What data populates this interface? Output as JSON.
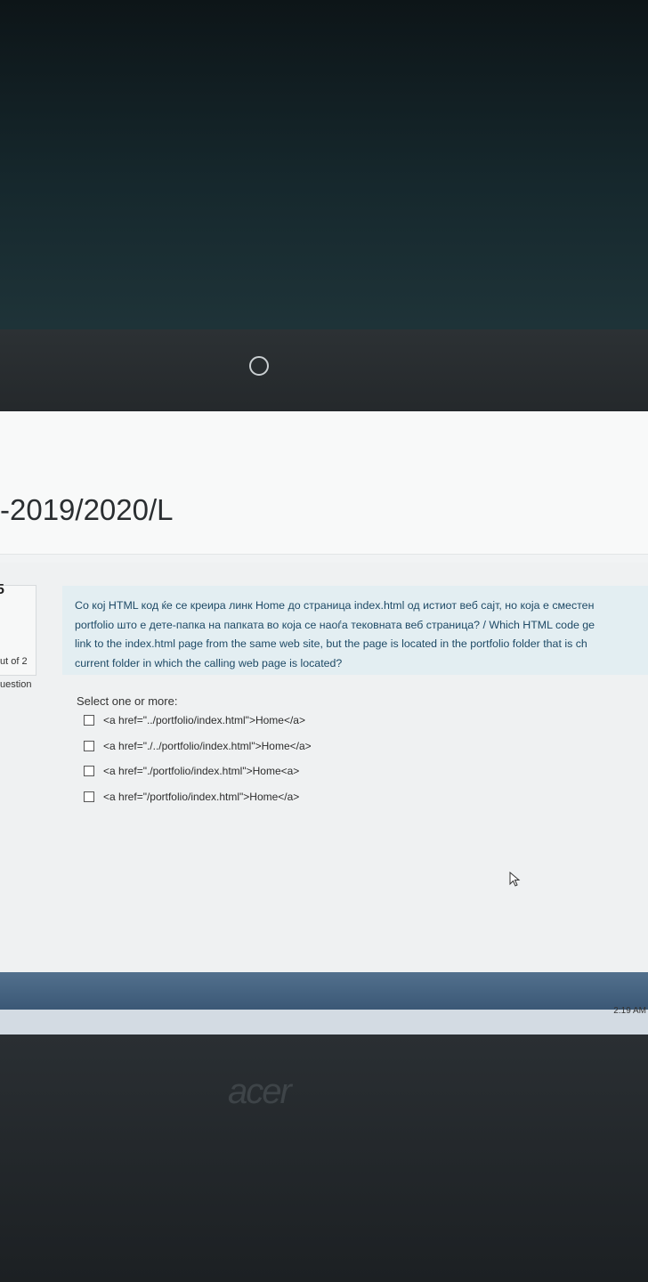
{
  "course": {
    "title": "-2019/2020/L"
  },
  "question_info": {
    "number": "5",
    "marked_out_of": "ut of 2",
    "flag_question": "uestion"
  },
  "question": {
    "text_lines": [
      "Со кој HTML код ќе се креира линк Home до страница index.html од истиот веб сајт, но која е сместен",
      "portfolio што е дете-папка на папката во која се наоѓа тековната веб страница? / Which HTML code ge",
      "link to the index.html page from the same web site, but the page is located in the portfolio folder that is ch",
      "current folder in which the calling web page is located?"
    ],
    "select_prompt": "Select one or more:",
    "options": [
      "<a href=\"../portfolio/index.html\">Home</a>",
      "<a href=\"./../portfolio/index.html\">Home</a>",
      "<a href=\"./portfolio/index.html\">Home<a>",
      "<a href=\"/portfolio/index.html\">Home</a>"
    ]
  },
  "taskbar": {
    "clock": "2:19 AM"
  },
  "laptop": {
    "brand": "acer"
  },
  "colors": {
    "question_bg": "#e3eef2",
    "question_text": "#1e4a66",
    "taskbar": "#3b5876"
  }
}
